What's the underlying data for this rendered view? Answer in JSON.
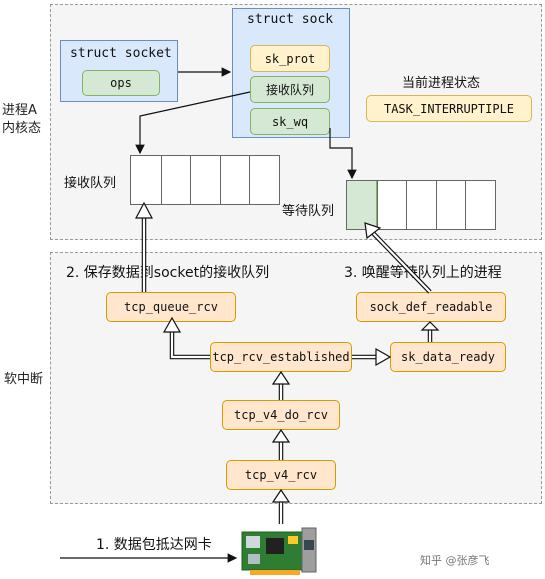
{
  "regions": {
    "kernel_label": "进程A\n内核态",
    "softirq_label": "软中断"
  },
  "sock": {
    "title": "struct sock",
    "sk_prot": "sk_prot",
    "recv_queue": "接收队列",
    "sk_wq": "sk_wq"
  },
  "socket": {
    "title": "struct socket",
    "ops": "ops"
  },
  "process_state": {
    "label": "当前进程状态",
    "value": "TASK_INTERRUPTIPLE"
  },
  "queues": {
    "recv_label": "接收队列",
    "wait_label": "等待队列"
  },
  "steps": {
    "step2": "2. 保存数据到socket的接收队列",
    "step3": "3. 唤醒等待队列上的进程",
    "step1": "1. 数据包抵达网卡"
  },
  "functions": {
    "tcp_queue_rcv": "tcp_queue_rcv",
    "sock_def_readable": "sock_def_readable",
    "tcp_rcv_established": "tcp_rcv_established",
    "sk_data_ready": "sk_data_ready",
    "tcp_v4_do_rcv": "tcp_v4_do_rcv",
    "tcp_v4_rcv": "tcp_v4_rcv"
  },
  "watermark": "知乎 @张彦飞",
  "colors": {
    "blue_fill": "#dae8fc",
    "yellow_fill": "#fff2cc",
    "green_fill": "#d5e8d4",
    "orange_fill": "#ffe6cc"
  }
}
